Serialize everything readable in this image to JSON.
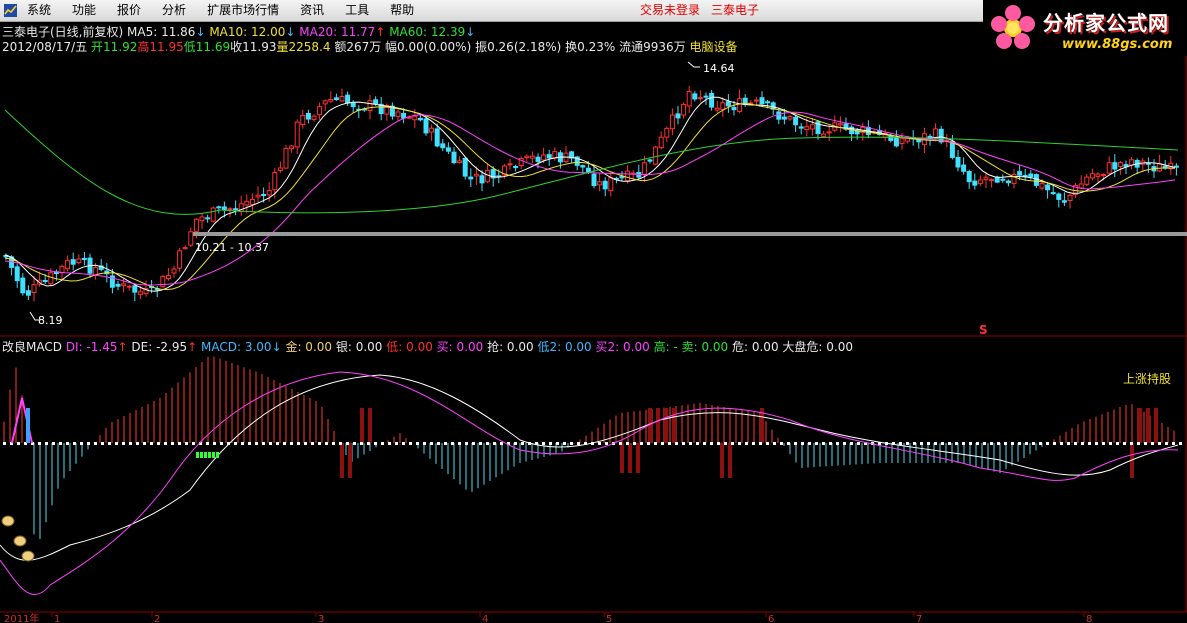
{
  "menu": [
    "系统",
    "功能",
    "报价",
    "分析",
    "扩展市场行情",
    "资讯",
    "工具",
    "帮助"
  ],
  "login_status": "交易未登录",
  "stock_name": "三泰电子",
  "logo": {
    "title": "分析家公式网",
    "url": "www.88gs.com"
  },
  "header": {
    "name": "三泰电子(日线,前复权)",
    "ma5": "MA5: 11.86",
    "ma10": "MA10: 12.00",
    "ma20": "MA20: 11.77",
    "ma60": "MA60: 12.39"
  },
  "quote": {
    "date": "2012/08/17/五",
    "open": "开11.92",
    "high": "高11.95",
    "low": "低11.69",
    "close": "收11.93",
    "volume": "量2258.4",
    "amount": "额267万",
    "change": "幅0.00(0.00%)",
    "amplitude": "振0.26(2.18%)",
    "turnover": "换0.23%",
    "float": "流通9936万",
    "industry": "电脑设备"
  },
  "annotations": {
    "peak": "14.64",
    "range": "10.21 - 10.37",
    "low": "8.19",
    "s_mark": "S"
  },
  "macd": {
    "title": "改良MACD",
    "di": "DI: -1.45",
    "de": "DE: -2.95",
    "macd": "MACD: 3.00",
    "jin": "金: 0.00",
    "yin": "银: 0.00",
    "di_low": "低: 0.00",
    "buy": "买: 0.00",
    "qiang": "抢: 0.00",
    "di2": "低2: 0.00",
    "buy2": "买2: 0.00",
    "gao_sell": "高: - 卖: 0.00",
    "wei": "危: 0.00",
    "market_risk": "大盘危: 0.00",
    "status": "上涨持股"
  },
  "axis": {
    "year": "2011年",
    "months": [
      "1",
      "2",
      "3",
      "4",
      "5",
      "6",
      "7",
      "8"
    ]
  },
  "colors": {
    "up": "#ff3030",
    "down": "#40e0ff",
    "ma5": "#ffffff",
    "ma10": "#f0e030",
    "ma20": "#ff40ff",
    "ma60": "#30d030",
    "frame": "#8b0000"
  }
}
